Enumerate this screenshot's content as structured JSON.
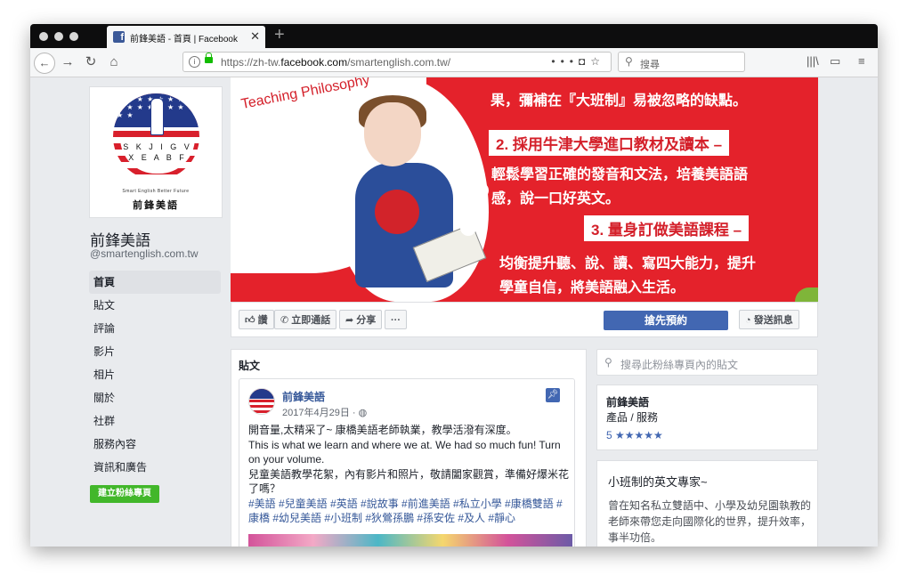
{
  "browser": {
    "tab_title": "前鋒美語 - 首頁 | Facebook",
    "tab_close": "✕",
    "new_tab": "+",
    "url_prefix": "https://zh-tw.",
    "url_domain": "facebook.com",
    "url_path": "/smartenglish.com.tw/",
    "search_placeholder": "搜尋",
    "accent": "#4267b2"
  },
  "page": {
    "logo_tag": "Smart English Better Future",
    "logo_name": "前鋒美語",
    "logo_letters": "S K J I G V X E A B F",
    "name": "前鋒美語",
    "handle": "@smartenglish.com.tw"
  },
  "nav": {
    "items": [
      "首頁",
      "貼文",
      "評論",
      "影片",
      "相片",
      "關於",
      "社群",
      "服務內容",
      "資訊和廣告"
    ],
    "create_page": "建立粉絲專頁"
  },
  "cover": {
    "philosophy": "Teaching Philosophy",
    "line_top": "果，彌補在『大班制』易被忽略的缺點。",
    "heading2": "2. 採用牛津大學進口教材及讀本 –",
    "line2a": "輕鬆學習正確的發音和文法，培養美語語",
    "line2b": "感，說一口好英文。",
    "heading3": "3. 量身訂做美語課程 –",
    "line3a": "均衡提升聽、說、讀、寫四大能力，提升",
    "line3b": "學童自信，將美語融入生活。"
  },
  "actions": {
    "like": "讚",
    "call": "立即通話",
    "share": "分享",
    "more": "···",
    "book": "搶先預約",
    "message": "發送訊息"
  },
  "posts": {
    "title": "貼文",
    "author": "前鋒美語",
    "date": "2017年4月29日",
    "line1": "開音量,太精采了~ 康橋美語老師執業，教學活潑有深度。",
    "line2": "This is what we learn and where we at. We had so much fun! Turn on your volume.",
    "line3": "兒童美語教學花絮，內有影片和照片，敬請闔家觀賞，準備好爆米花了嗎？",
    "tags": "#美語 #兒童美語 #英語 #說故事 #前進美語 #私立小學 #康橋雙語 #康橋 #幼兒美語 #小班制 #狄鶯孫鵬 #孫安佐 #及人 #靜心"
  },
  "sidebar": {
    "search_placeholder": "搜尋此粉絲專頁內的貼文",
    "info_name": "前鋒美語",
    "info_category": "產品 / 服務",
    "rating": "5 ★★★★★",
    "about_title": "小班制的英文專家~",
    "about_text": "曾在知名私立雙語中、小學及幼兒園執教的老師來帶您走向國際化的世界，提升效率，事半功倍。"
  }
}
